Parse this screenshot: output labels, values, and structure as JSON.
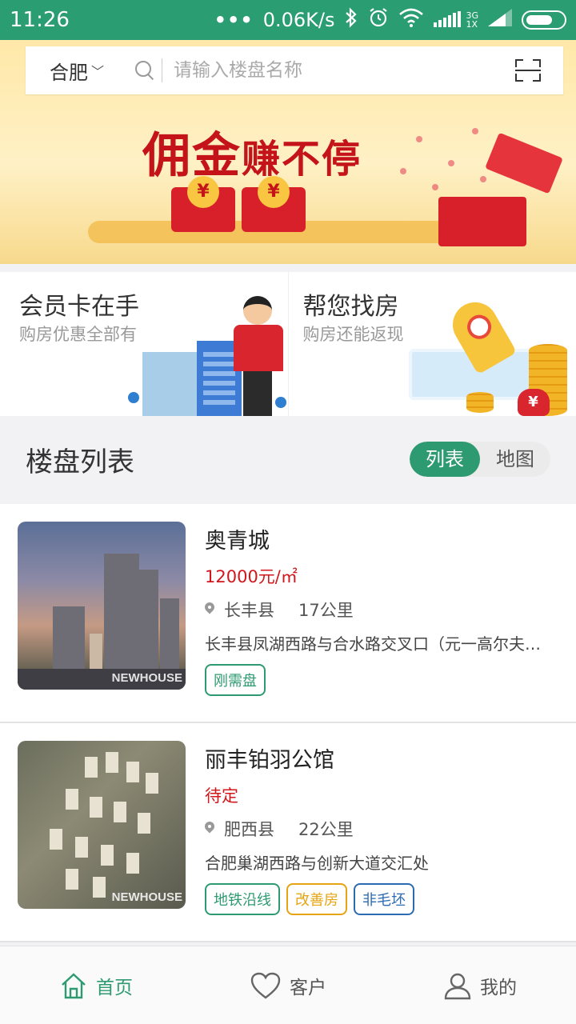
{
  "status_bar": {
    "time": "11:26",
    "speed": "0.06K/s",
    "net_type": "3G",
    "sim_label": "1X"
  },
  "search": {
    "city": "合肥",
    "placeholder": "请输入楼盘名称"
  },
  "banner": {
    "slogan_big": "佣金",
    "slogan_rest": "赚不停"
  },
  "promos": [
    {
      "title": "会员卡在手",
      "subtitle": "购房优惠全部有"
    },
    {
      "title": "帮您找房",
      "subtitle": "购房还能返现"
    }
  ],
  "section": {
    "title": "楼盘列表",
    "view_toggle": {
      "list": "列表",
      "map": "地图",
      "selected": "列表"
    }
  },
  "listings": [
    {
      "name": "奥青城",
      "price": "12000元/㎡",
      "district": "长丰县",
      "distance": "17公里",
      "address": "长丰县凤湖西路与合水路交叉口（元一高尔夫…",
      "tags": [
        {
          "label": "刚需盘",
          "color": "green"
        }
      ],
      "watermark": "NEWHOUSE"
    },
    {
      "name": "丽丰铂羽公馆",
      "price": "待定",
      "district": "肥西县",
      "distance": "22公里",
      "address": "合肥巢湖西路与创新大道交汇处",
      "tags": [
        {
          "label": "地铁沿线",
          "color": "green"
        },
        {
          "label": "改善房",
          "color": "orange"
        },
        {
          "label": "非毛坯",
          "color": "blue"
        }
      ],
      "watermark": "NEWHOUSE"
    }
  ],
  "bottom_nav": [
    {
      "label": "首页",
      "icon": "home-icon",
      "active": true
    },
    {
      "label": "客户",
      "icon": "heart-icon",
      "active": false
    },
    {
      "label": "我的",
      "icon": "user-icon",
      "active": false
    }
  ],
  "colors": {
    "brand": "#2e9a71",
    "status_bar": "#2a9d72",
    "price_red": "#d1161c",
    "tag_orange": "#e6a412",
    "tag_blue": "#2c6bb1"
  }
}
